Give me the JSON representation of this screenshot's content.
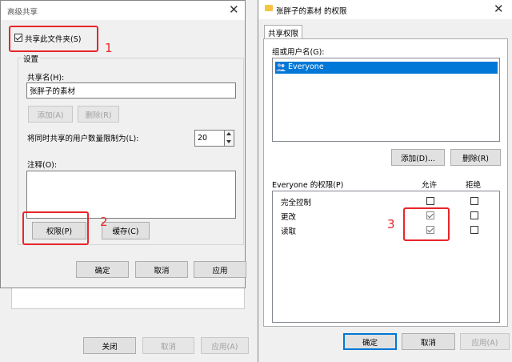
{
  "left": {
    "title": "高级共享",
    "share_checkbox_label": "共享此文件夹(S)",
    "settings_group_label": "设置",
    "share_name_label": "共享名(H):",
    "share_name_value": "张胖子的素材",
    "add_button": "添加(A)",
    "delete_button": "删除(R)",
    "limit_label": "将同时共享的用户数量限制为(L):",
    "limit_value": "20",
    "comment_label": "注释(O):",
    "permissions_button": "权限(P)",
    "cache_button": "缓存(C)",
    "ok_button": "确定",
    "cancel_button": "取消",
    "apply_button": "应用"
  },
  "back_window": {
    "close_button": "关闭",
    "cancel_button": "取消",
    "apply_button": "应用(A)"
  },
  "right": {
    "title": "张胖子的素材 的权限",
    "tab": "共享权限",
    "group_label": "组或用户名(G):",
    "users": [
      "Everyone"
    ],
    "add_button": "添加(D)...",
    "remove_button": "删除(R)",
    "perm_header": "Everyone 的权限(P)",
    "allow_header": "允许",
    "deny_header": "拒绝",
    "permissions": [
      {
        "name": "完全控制",
        "allow": false,
        "deny": false
      },
      {
        "name": "更改",
        "allow": true,
        "deny": false
      },
      {
        "name": "读取",
        "allow": true,
        "deny": false
      }
    ],
    "ok_button": "确定",
    "cancel_button": "取消",
    "apply_button": "应用(A)"
  },
  "annotations": [
    "1",
    "2",
    "3"
  ],
  "colors": {
    "annotation_red": "#e8262a",
    "selection_blue": "#0078d7"
  }
}
